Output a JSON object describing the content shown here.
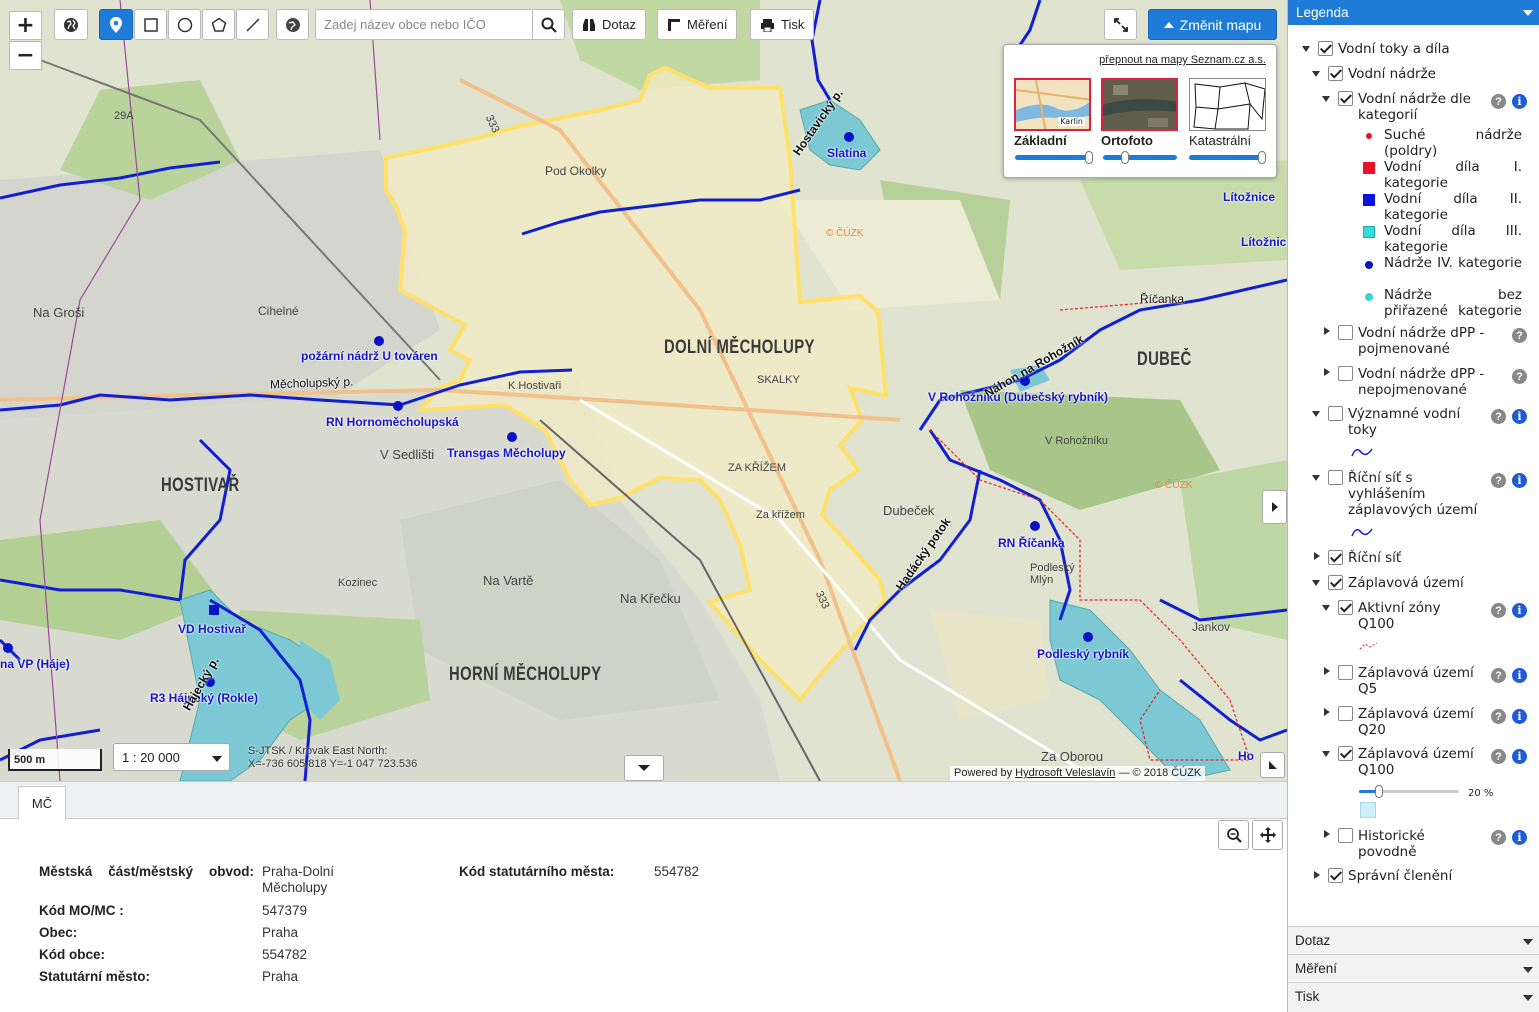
{
  "toolbar": {
    "zoom_in": "+",
    "zoom_out": "−",
    "search_placeholder": "Zadej název obce nebo IČO",
    "query_label": "Dotaz",
    "measure_label": "Měření",
    "print_label": "Tisk",
    "change_map_label": "Změnit mapu"
  },
  "map_switcher": {
    "seznam_link": "přepnout na mapy Seznam.cz a.s.",
    "options": [
      {
        "label": "Základní",
        "selected": true,
        "opacity_pct": 100,
        "thumb_text": "Karlín"
      },
      {
        "label": "Ortofoto",
        "selected": true,
        "opacity_pct": 25
      },
      {
        "label": "Katastrální",
        "selected": false,
        "opacity_pct": 100
      }
    ]
  },
  "map": {
    "labels": {
      "slatina": "Slatina",
      "pozarni": "požární nádrž U továren",
      "hornomech": "RN Hornoměcholupská",
      "transgas": "Transgas Měcholupy",
      "vd_hostivar": "VD Hostivař",
      "vp_haje": "na VP (Háje)",
      "hajecky": "R3 Hájecký (Rokle)",
      "rohozniku": "V Rohožníku (Dubečský rybník)",
      "ricanka_rn": "RN Říčanka",
      "podlesky": "Podleský rybník",
      "dolni": "DOLNÍ MĚCHOLUPY",
      "horni": "HORNÍ MĚCHOLUPY",
      "hostivar": "HOSTIVAŘ",
      "dubec": "DUBEČ",
      "ricanka": "Říčanka",
      "litozn1": "Lítožnice",
      "litozn2": "Lítožnice",
      "mecholupsky": "Měcholupský p.",
      "hostavicky": "Hostavický p.",
      "nahon": "Náhon na Rohožník",
      "hadacky": "Hadácký potok",
      "hajecky_p": "Hájecký p.",
      "pod_okolky": "Pod Okolky",
      "na_grosi": "Na Groši",
      "cihelne": "Cihelné",
      "k_hostivari": "K Hostivaři",
      "v_sedlisti": "V Sedlišti",
      "na_varte": "Na Vartě",
      "na_krecku": "Na Křečku",
      "kozinec": "Kozinec",
      "skalky": "SKALKY",
      "za_krizem": "ZA KŘÍŽEM",
      "za_krizem2": "Za křížem",
      "dubecek": "Dubeček",
      "podleský_mlyn": "Podleský Mlýn",
      "jankov": "Jankov",
      "za_oborou": "Za Oborou",
      "cuzk1": "© ČÚZK",
      "cuzk2": "© ČÚZK",
      "road333a": "333",
      "road333b": "333",
      "road29a": "29A",
      "v_rohozniku": "V Rohožníku",
      "ho": "Ho"
    },
    "scale_bar": "500 m",
    "scale_select": "1 : 20 000",
    "coords_line1": "S-JTSK / Krovak East North:",
    "coords_line2": "X=-736 605.818 Y=-1 047 723.536",
    "attribution_prefix": "Powered by",
    "attribution_link": "Hydrosoft Veleslavín",
    "attribution_suffix": "— © 2018 ČÚZK"
  },
  "info_panel": {
    "tab": "MČ",
    "left_rows": [
      {
        "key": "Městská část/městský obvod:",
        "value": "Praha-Dolní Měcholupy"
      },
      {
        "key": "Kód MO/MC :",
        "value": "547379"
      },
      {
        "key": "Obec:",
        "value": "Praha"
      },
      {
        "key": "Kód obce:",
        "value": "554782"
      },
      {
        "key": "Statutární město:",
        "value": "Praha"
      }
    ],
    "right_rows": [
      {
        "key": "Kód statutárního města:",
        "value": "554782"
      }
    ]
  },
  "legend": {
    "title": "Legenda",
    "items": {
      "vodni_toky": "Vodní toky a díla",
      "vodni_nadrze": "Vodní nádrže",
      "nadrze_dle_kat": "Vodní nádrže dle kategorií",
      "suche": "Suché nádrže (poldry)",
      "kat1": "Vodní díla I. kategorie",
      "kat2": "Vodní díla II. kategorie",
      "kat3": "Vodní díla III. kategorie",
      "kat4": "Nádrže IV. kategorie",
      "bez": "Nádrže bez přiřazené kategorie",
      "dpp_pojm": "Vodní nádrže dPP - pojmenované",
      "dpp_nepojm": "Vodní nádrže dPP - nepojmenované",
      "vyznamne": "Významné vodní toky",
      "ricni_sit_zapl": "Říční síť s vyhlášením záplavových území",
      "ricni_sit": "Říční síť",
      "zaplavova": "Záplavová území",
      "aktivni": "Aktivní zóny Q100",
      "q5": "Záplavová území Q5",
      "q20": "Záplavová území Q20",
      "q100": "Záplavová území Q100",
      "q100_opacity": "20 %",
      "historicke": "Historické povodně",
      "spravni": "Správní členění"
    },
    "accordion": [
      "Dotaz",
      "Měření",
      "Tisk"
    ],
    "colors": {
      "suche": "#e8102a",
      "kat1": "#e8102a",
      "kat2": "#0a12e0",
      "kat3": "#33dddd",
      "kat4": "#0a12c8",
      "bez": "#3cd4d4",
      "q100_fill": "#cfefff",
      "river": "#1020d0",
      "boundary": "#ffe680"
    }
  }
}
